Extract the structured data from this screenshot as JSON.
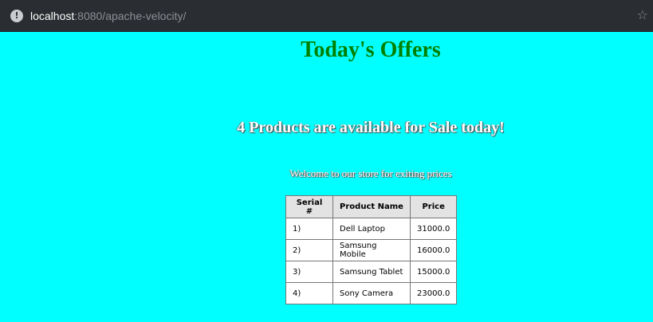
{
  "browser": {
    "url_host": "localhost",
    "url_rest": ":8080/apache-velocity/"
  },
  "page": {
    "title": "Today's Offers",
    "subtitle": "4 Products are available for Sale today!",
    "welcome": "Welcome to our store for exiting prices"
  },
  "table": {
    "headers": [
      "Serial #",
      "Product Name",
      "Price"
    ],
    "rows": [
      [
        "1)",
        "Dell Laptop",
        "31000.0"
      ],
      [
        "2)",
        "Samsung Mobile",
        "16000.0"
      ],
      [
        "3)",
        "Samsung Tablet",
        "15000.0"
      ],
      [
        "4)",
        "Sony Camera",
        "23000.0"
      ]
    ]
  },
  "colors": {
    "background": "#00ffff",
    "title": "#008000",
    "header_bg": "#e3e3e3"
  },
  "icons": {
    "site_info": "info-icon",
    "bookmark": "star-icon"
  }
}
